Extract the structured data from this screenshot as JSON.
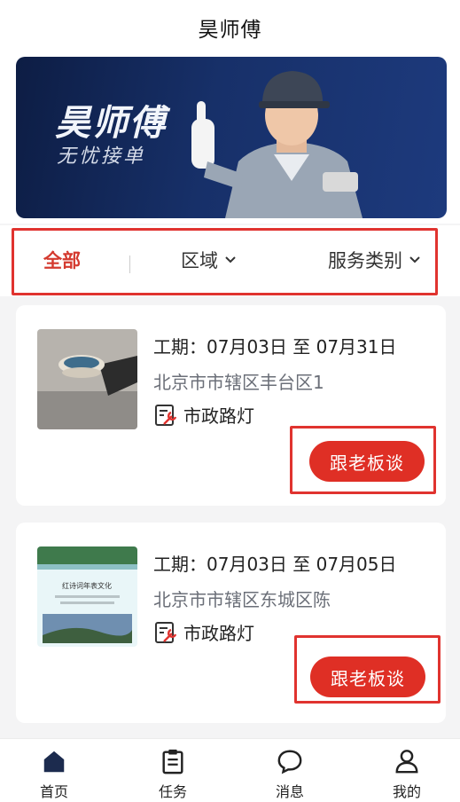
{
  "header": {
    "title": "昊师傅"
  },
  "banner": {
    "title": "昊师傅",
    "subtitle": "无忧接单"
  },
  "filters": {
    "all": "全部",
    "region": "区域",
    "service": "服务类别"
  },
  "orders": [
    {
      "period": "工期：07月03日 至 07月31日",
      "address": "北京市市辖区丰台区1",
      "category": "市政路灯",
      "button": "跟老板谈"
    },
    {
      "period": "工期：07月03日 至 07月05日",
      "address": "北京市市辖区东城区陈",
      "category": "市政路灯",
      "button": "跟老板谈"
    }
  ],
  "tabs": [
    {
      "label": "首页",
      "icon": "home-icon"
    },
    {
      "label": "任务",
      "icon": "clipboard-icon"
    },
    {
      "label": "消息",
      "icon": "chat-icon"
    },
    {
      "label": "我的",
      "icon": "user-icon"
    }
  ],
  "thumb_doc_heading": "红诗词年表文化",
  "colors": {
    "accent": "#df2f25",
    "highlight_outline": "#e0332f",
    "nav_active": "#1c2b4e"
  }
}
